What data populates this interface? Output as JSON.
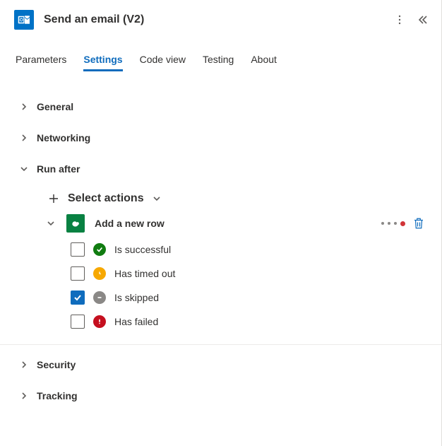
{
  "header": {
    "title": "Send an email (V2)"
  },
  "tabs": {
    "parameters": "Parameters",
    "settings": "Settings",
    "codeview": "Code view",
    "testing": "Testing",
    "about": "About"
  },
  "sections": {
    "general": "General",
    "networking": "Networking",
    "runafter": "Run after",
    "security": "Security",
    "tracking": "Tracking"
  },
  "runafter": {
    "select_label": "Select actions",
    "action_title": "Add a new row",
    "options": {
      "success": "Is successful",
      "timedout": "Has timed out",
      "skipped": "Is skipped",
      "failed": "Has failed"
    }
  }
}
